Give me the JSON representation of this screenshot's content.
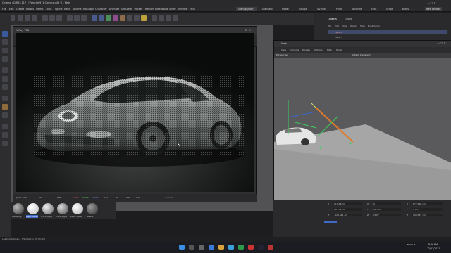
{
  "app": {
    "title": "Cinema 4D R25.117 - [Porsche 911 Camera.c4d *] - Main",
    "layouts": [
      "Startup (User)",
      "Standard",
      "Model",
      "Sculpt",
      "UV Edit",
      "Paint",
      "Animate",
      "Track",
      "Script",
      "Nodes",
      "Redshift"
    ],
    "new_layouts": "New Layouts"
  },
  "menubar": [
    "File",
    "Edit",
    "Create",
    "Modes",
    "Select",
    "Tools",
    "Spline",
    "Mesh",
    "Volume",
    "MoGraph",
    "Character",
    "Animate",
    "Simulate",
    "Tracker",
    "Render",
    "Extensions",
    "V-Ray",
    "Window",
    "Help"
  ],
  "vfb": {
    "title": "V-Ray VFB",
    "menu": [
      "File",
      "Render",
      "Image",
      "View",
      "Options"
    ],
    "notice": "New version available",
    "channel": "RGB color",
    "status": [
      "[631, 334]",
      "1x1",
      "Raw",
      "0.000",
      "0.000",
      "0.000",
      "HSV",
      "0",
      "0.0",
      "0.0"
    ],
    "progress": "Finished"
  },
  "materials": [
    "Car Body",
    "Light Mater",
    "Front Light",
    "Front Light",
    "Light Mater",
    "Scene"
  ],
  "objects": {
    "tabs": [
      "Objects",
      "Takes"
    ],
    "menu": [
      "File",
      "Edit",
      "View",
      "Object",
      "Tags",
      "Bookmarks"
    ],
    "items": [
      "Plane.2",
      "Plane.1"
    ]
  },
  "view": {
    "title": "View",
    "menu": [
      "View",
      "Cameras",
      "Display",
      "Options",
      "Filter",
      "Panel"
    ],
    "projection": "Perspective",
    "camera": "Default Camera ⟐"
  },
  "attributes": {
    "rows": [
      {
        "a": "X",
        "v1": "115.46 cm",
        "b": "X",
        "v2": "0 °",
        "c": "X",
        "v3": "877.698 cm"
      },
      {
        "a": "Y",
        "v1": "80.171 cm",
        "b": "Y",
        "v2": "22.753 °",
        "c": "Y",
        "v3": "0 cm"
      },
      {
        "a": "Z",
        "v1": "-644.841 cm",
        "b": "Z",
        "v2": "180 °",
        "c": "Z",
        "v3": "298.847 cm"
      }
    ]
  },
  "statusbar": "Loading Jobmap... [Finished in 0h 0m 0s]",
  "taskbar": {
    "time": "8:06 PM",
    "date": "12/11/2021",
    "lang": "ENG US"
  }
}
